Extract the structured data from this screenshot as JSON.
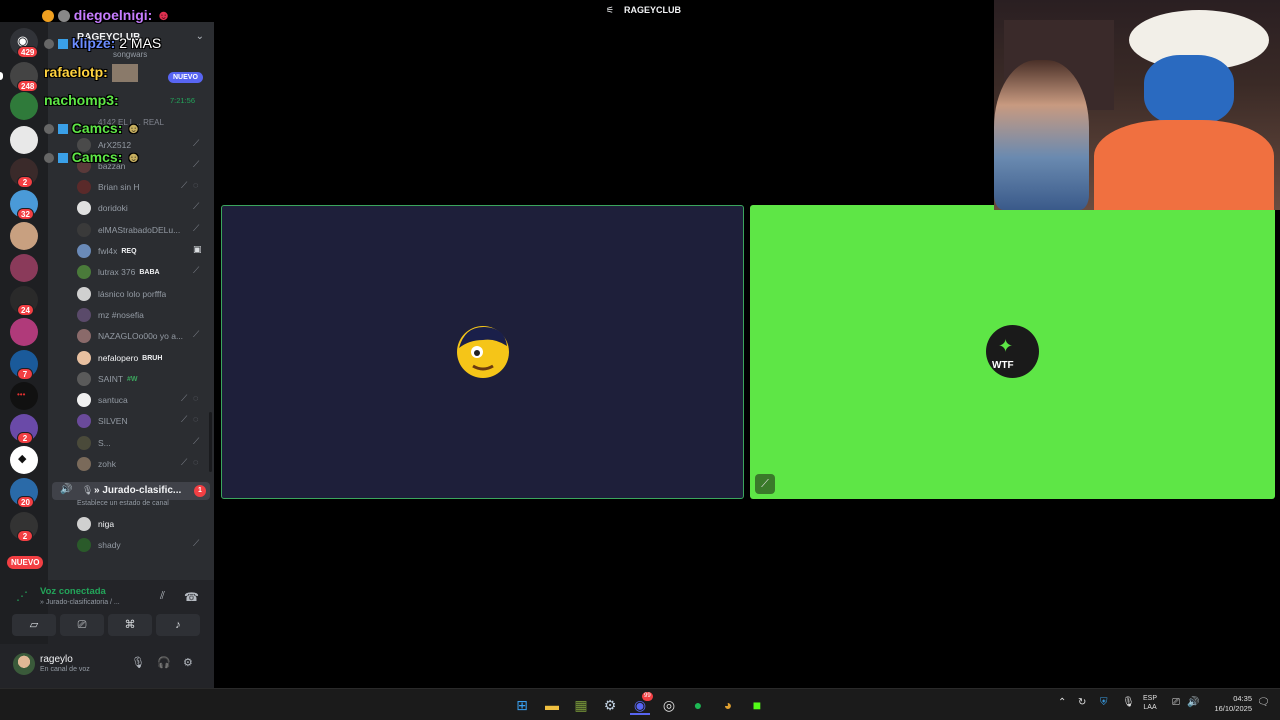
{
  "window": {
    "title": "RAGEYCLUB"
  },
  "guild": {
    "name": "RAGEYCLUB"
  },
  "rail": {
    "badges": [
      "429",
      "248",
      "2",
      "32",
      "2",
      "24",
      "7",
      "2",
      "20",
      "2"
    ],
    "new_label": "NUEVO"
  },
  "channels": {
    "songwars": "songwars",
    "nuevo_tag": "NUEVO",
    "timer": "7:21:56",
    "room_real": "4142 EL L... REAL"
  },
  "voice_users": [
    {
      "name": "ArX2512"
    },
    {
      "name": "bazzan"
    },
    {
      "name": "Brian sin H"
    },
    {
      "name": "doridoki"
    },
    {
      "name": "elMAStrabadoDELu..."
    },
    {
      "name": "fwl4x",
      "tag": "REQ"
    },
    {
      "name": "lutrax 376",
      "tag": "BABA"
    },
    {
      "name": "lásnico lolo porfffa"
    },
    {
      "name": "mz #nosefia"
    },
    {
      "name": "NAZAGLOo00o yo a..."
    },
    {
      "name": "nefalopero",
      "tag": "BRUH"
    },
    {
      "name": "SAINT",
      "tag": "#W"
    },
    {
      "name": "santuca"
    },
    {
      "name": "SILVEN"
    },
    {
      "name": "S..."
    },
    {
      "name": "zohk"
    }
  ],
  "jurado": {
    "label": "» Jurado-clasific...",
    "badge": "1",
    "status": "Establece un estado de canal"
  },
  "jurado_users": [
    {
      "name": "niga"
    },
    {
      "name": "shady"
    }
  ],
  "voice": {
    "status": "Voz conectada",
    "channel": "» Jurado-clasificatoria / ..."
  },
  "user": {
    "name": "rageylo",
    "status": "En canal de voz"
  },
  "chat": [
    {
      "user": "diegoelnigi:",
      "color": "#c77dff"
    },
    {
      "user": "klipze:",
      "message": "2 MAS",
      "color": "#6b8cff"
    },
    {
      "user": "rafaelotp:",
      "color": "#ffd23f"
    },
    {
      "user": "nachomp3:",
      "color": "#5ee646"
    },
    {
      "user": "Camcs:",
      "color": "#5ee646"
    },
    {
      "user": "Camcs:",
      "color": "#5ee646"
    }
  ],
  "tiles": {
    "tile2_avatar_text": "WTF"
  },
  "taskbar": {
    "lang_1": "ESP",
    "lang_2": "LAA",
    "time": "04:35",
    "date": "16/10/2025",
    "discord_badge": "99"
  },
  "colors": {
    "speaking_border": "#3ba55d",
    "tile2_bg": "#5ee646",
    "accent_red": "#f23f43"
  }
}
